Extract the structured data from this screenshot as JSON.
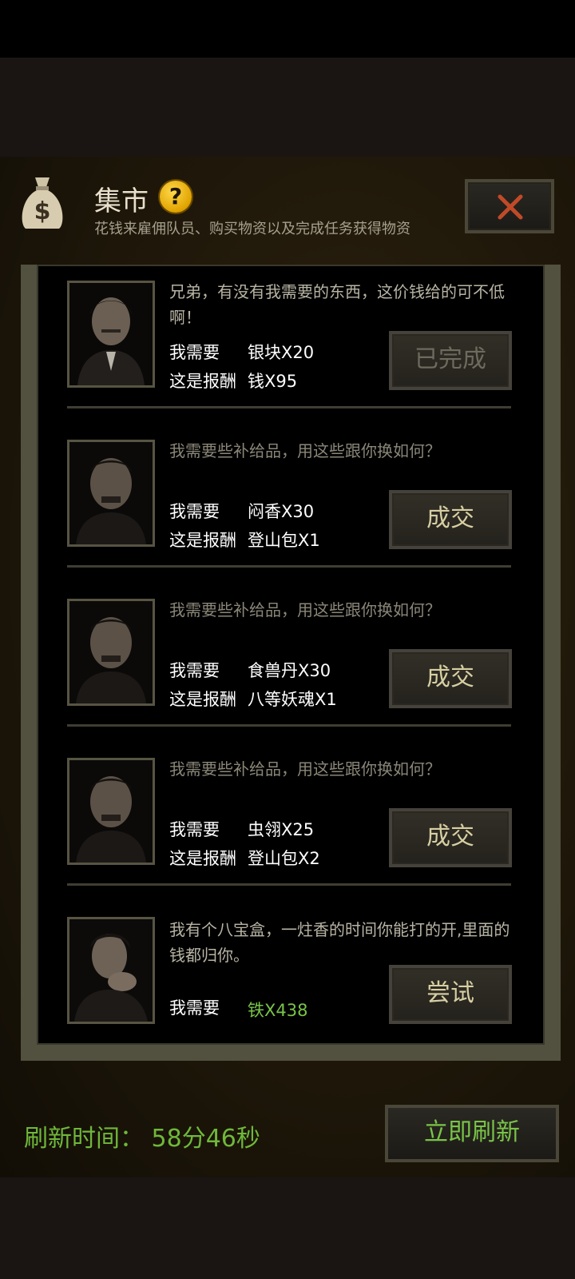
{
  "header": {
    "title": "集市",
    "subtitle": "花钱来雇佣队员、购买物资以及完成任务获得物资",
    "help": "?"
  },
  "items": [
    {
      "message": "兄弟，有没有我需要的东西，这价钱给的可不低啊！",
      "need_label": "我需要",
      "need_value": "银块X20",
      "reward_label": "这是报酬",
      "reward_value": "钱X95",
      "button": "已完成"
    },
    {
      "message": "我需要些补给品，用这些跟你换如何？",
      "need_label": "我需要",
      "need_value": "闷香X30",
      "reward_label": "这是报酬",
      "reward_value": "登山包X1",
      "button": "成交"
    },
    {
      "message": "我需要些补给品，用这些跟你换如何？",
      "need_label": "我需要",
      "need_value": "食兽丹X30",
      "reward_label": "这是报酬",
      "reward_value": "八等妖魂X1",
      "button": "成交"
    },
    {
      "message": "我需要些补给品，用这些跟你换如何？",
      "need_label": "我需要",
      "need_value": "虫翎X25",
      "reward_label": "这是报酬",
      "reward_value": "登山包X2",
      "button": "成交"
    },
    {
      "message": "我有个八宝盒，一炷香的时间你能打的开,里面的钱都归你。",
      "need_label": "我需要",
      "need_value": "铁X438",
      "button": "尝试"
    }
  ],
  "footer": {
    "refresh_time": "刷新时间：  58分46秒",
    "refresh_button": "立即刷新"
  },
  "colors": {
    "accent_green": "#79c448",
    "gold": "#d7cfa2",
    "panel_border": "#52503f"
  },
  "icons": [
    "money-bag-icon",
    "help-icon",
    "close-icon"
  ]
}
